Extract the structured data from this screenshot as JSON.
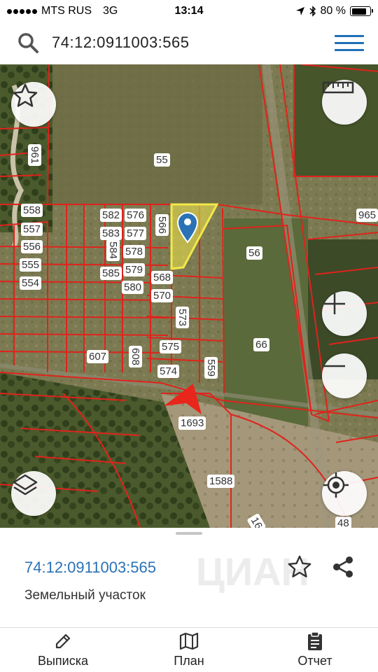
{
  "status": {
    "carrier": "MTS RUS",
    "network": "3G",
    "time": "13:14",
    "battery_percent": "80 %",
    "battery_level": 0.8,
    "icons": [
      "location-arrow-icon",
      "bluetooth-icon",
      "battery-icon"
    ]
  },
  "search": {
    "query": "74:12:0911003:565"
  },
  "map": {
    "plot_labels": [
      {
        "id": "961",
        "text": "961"
      },
      {
        "id": "55",
        "text": "55"
      },
      {
        "id": "558",
        "text": "558"
      },
      {
        "id": "557",
        "text": "557"
      },
      {
        "id": "556",
        "text": "556"
      },
      {
        "id": "555",
        "text": "555"
      },
      {
        "id": "554",
        "text": "554"
      },
      {
        "id": "582",
        "text": "582"
      },
      {
        "id": "576",
        "text": "576"
      },
      {
        "id": "583",
        "text": "583"
      },
      {
        "id": "577",
        "text": "577"
      },
      {
        "id": "566",
        "text": "566"
      },
      {
        "id": "584",
        "text": "584"
      },
      {
        "id": "578",
        "text": "578"
      },
      {
        "id": "585",
        "text": "585"
      },
      {
        "id": "579",
        "text": "579"
      },
      {
        "id": "580",
        "text": "580"
      },
      {
        "id": "568",
        "text": "568"
      },
      {
        "id": "570",
        "text": "570"
      },
      {
        "id": "573",
        "text": "573"
      },
      {
        "id": "56",
        "text": "56"
      },
      {
        "id": "965",
        "text": "965"
      },
      {
        "id": "575",
        "text": "575"
      },
      {
        "id": "574",
        "text": "574"
      },
      {
        "id": "559",
        "text": "559"
      },
      {
        "id": "607",
        "text": "607"
      },
      {
        "id": "608",
        "text": "608"
      },
      {
        "id": "66",
        "text": "66"
      },
      {
        "id": "1693",
        "text": "1693"
      },
      {
        "id": "1588",
        "text": "1588"
      },
      {
        "id": "16",
        "text": "16"
      },
      {
        "id": "48",
        "text": "48"
      }
    ],
    "buttons": {
      "favorite": "star-icon",
      "ruler": "ruler-icon",
      "zoom_in": "plus-icon",
      "zoom_out": "minus-icon",
      "layers": "layers-icon",
      "locate": "crosshair-icon"
    },
    "colors": {
      "boundary": "#e0231c",
      "selected_fill": "#f2e84a",
      "pin": "#2a72b5",
      "arrow": "#e8261c"
    }
  },
  "sheet": {
    "parcel_id": "74:12:0911003:565",
    "parcel_type": "Земельный участок",
    "watermark": "ЦИАН"
  },
  "tabs": [
    {
      "label": "Выписка",
      "icon": "pencil-icon"
    },
    {
      "label": "План",
      "icon": "map-icon"
    },
    {
      "label": "Отчет",
      "icon": "clipboard-icon"
    }
  ]
}
